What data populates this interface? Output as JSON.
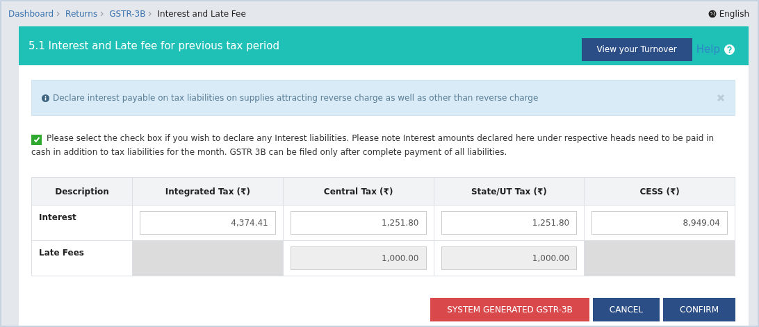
{
  "breadcrumb": [
    {
      "label": "Dashboard",
      "current": false
    },
    {
      "label": "Returns",
      "current": false
    },
    {
      "label": "GSTR-3B",
      "current": false
    },
    {
      "label": "Interest and Late Fee",
      "current": true
    }
  ],
  "language": "English",
  "panel": {
    "title": "5.1 Interest and Late fee for previous tax period",
    "turnover_button": "View your Turnover",
    "help": "Help"
  },
  "info": {
    "text": "Declare interest payable on tax liabilities on supplies attracting reverse charge as well as other than reverse charge"
  },
  "declare": {
    "checked": true,
    "text": "Please select the check box if you wish to declare any Interest liabilities. Please note Interest amounts declared here under respective heads need to be paid in cash in addition to tax liabilities for the month. GSTR 3B can be filed only after complete payment of all liabilities."
  },
  "table": {
    "columns": [
      "Description",
      "Integrated Tax (₹)",
      "Central Tax (₹)",
      "State/UT Tax (₹)",
      "CESS (₹)"
    ],
    "rows": [
      {
        "cells": [
          {
            "kind": "label",
            "value": "Interest"
          },
          {
            "kind": "input",
            "value": "4,374.41",
            "disabled": false
          },
          {
            "kind": "input",
            "value": "1,251.80",
            "disabled": false
          },
          {
            "kind": "input",
            "value": "1,251.80",
            "disabled": false
          },
          {
            "kind": "input",
            "value": "8,949.04",
            "disabled": false
          }
        ]
      },
      {
        "cells": [
          {
            "kind": "label",
            "value": "Late Fees"
          },
          {
            "kind": "blank"
          },
          {
            "kind": "input",
            "value": "1,000.00",
            "disabled": true
          },
          {
            "kind": "input",
            "value": "1,000.00",
            "disabled": true
          },
          {
            "kind": "blank"
          }
        ]
      }
    ]
  },
  "buttons": [
    {
      "label": "SYSTEM GENERATED GSTR-3B",
      "kind": "danger"
    },
    {
      "label": "CANCEL",
      "kind": "primary"
    },
    {
      "label": "CONFIRM",
      "kind": "primary"
    }
  ]
}
